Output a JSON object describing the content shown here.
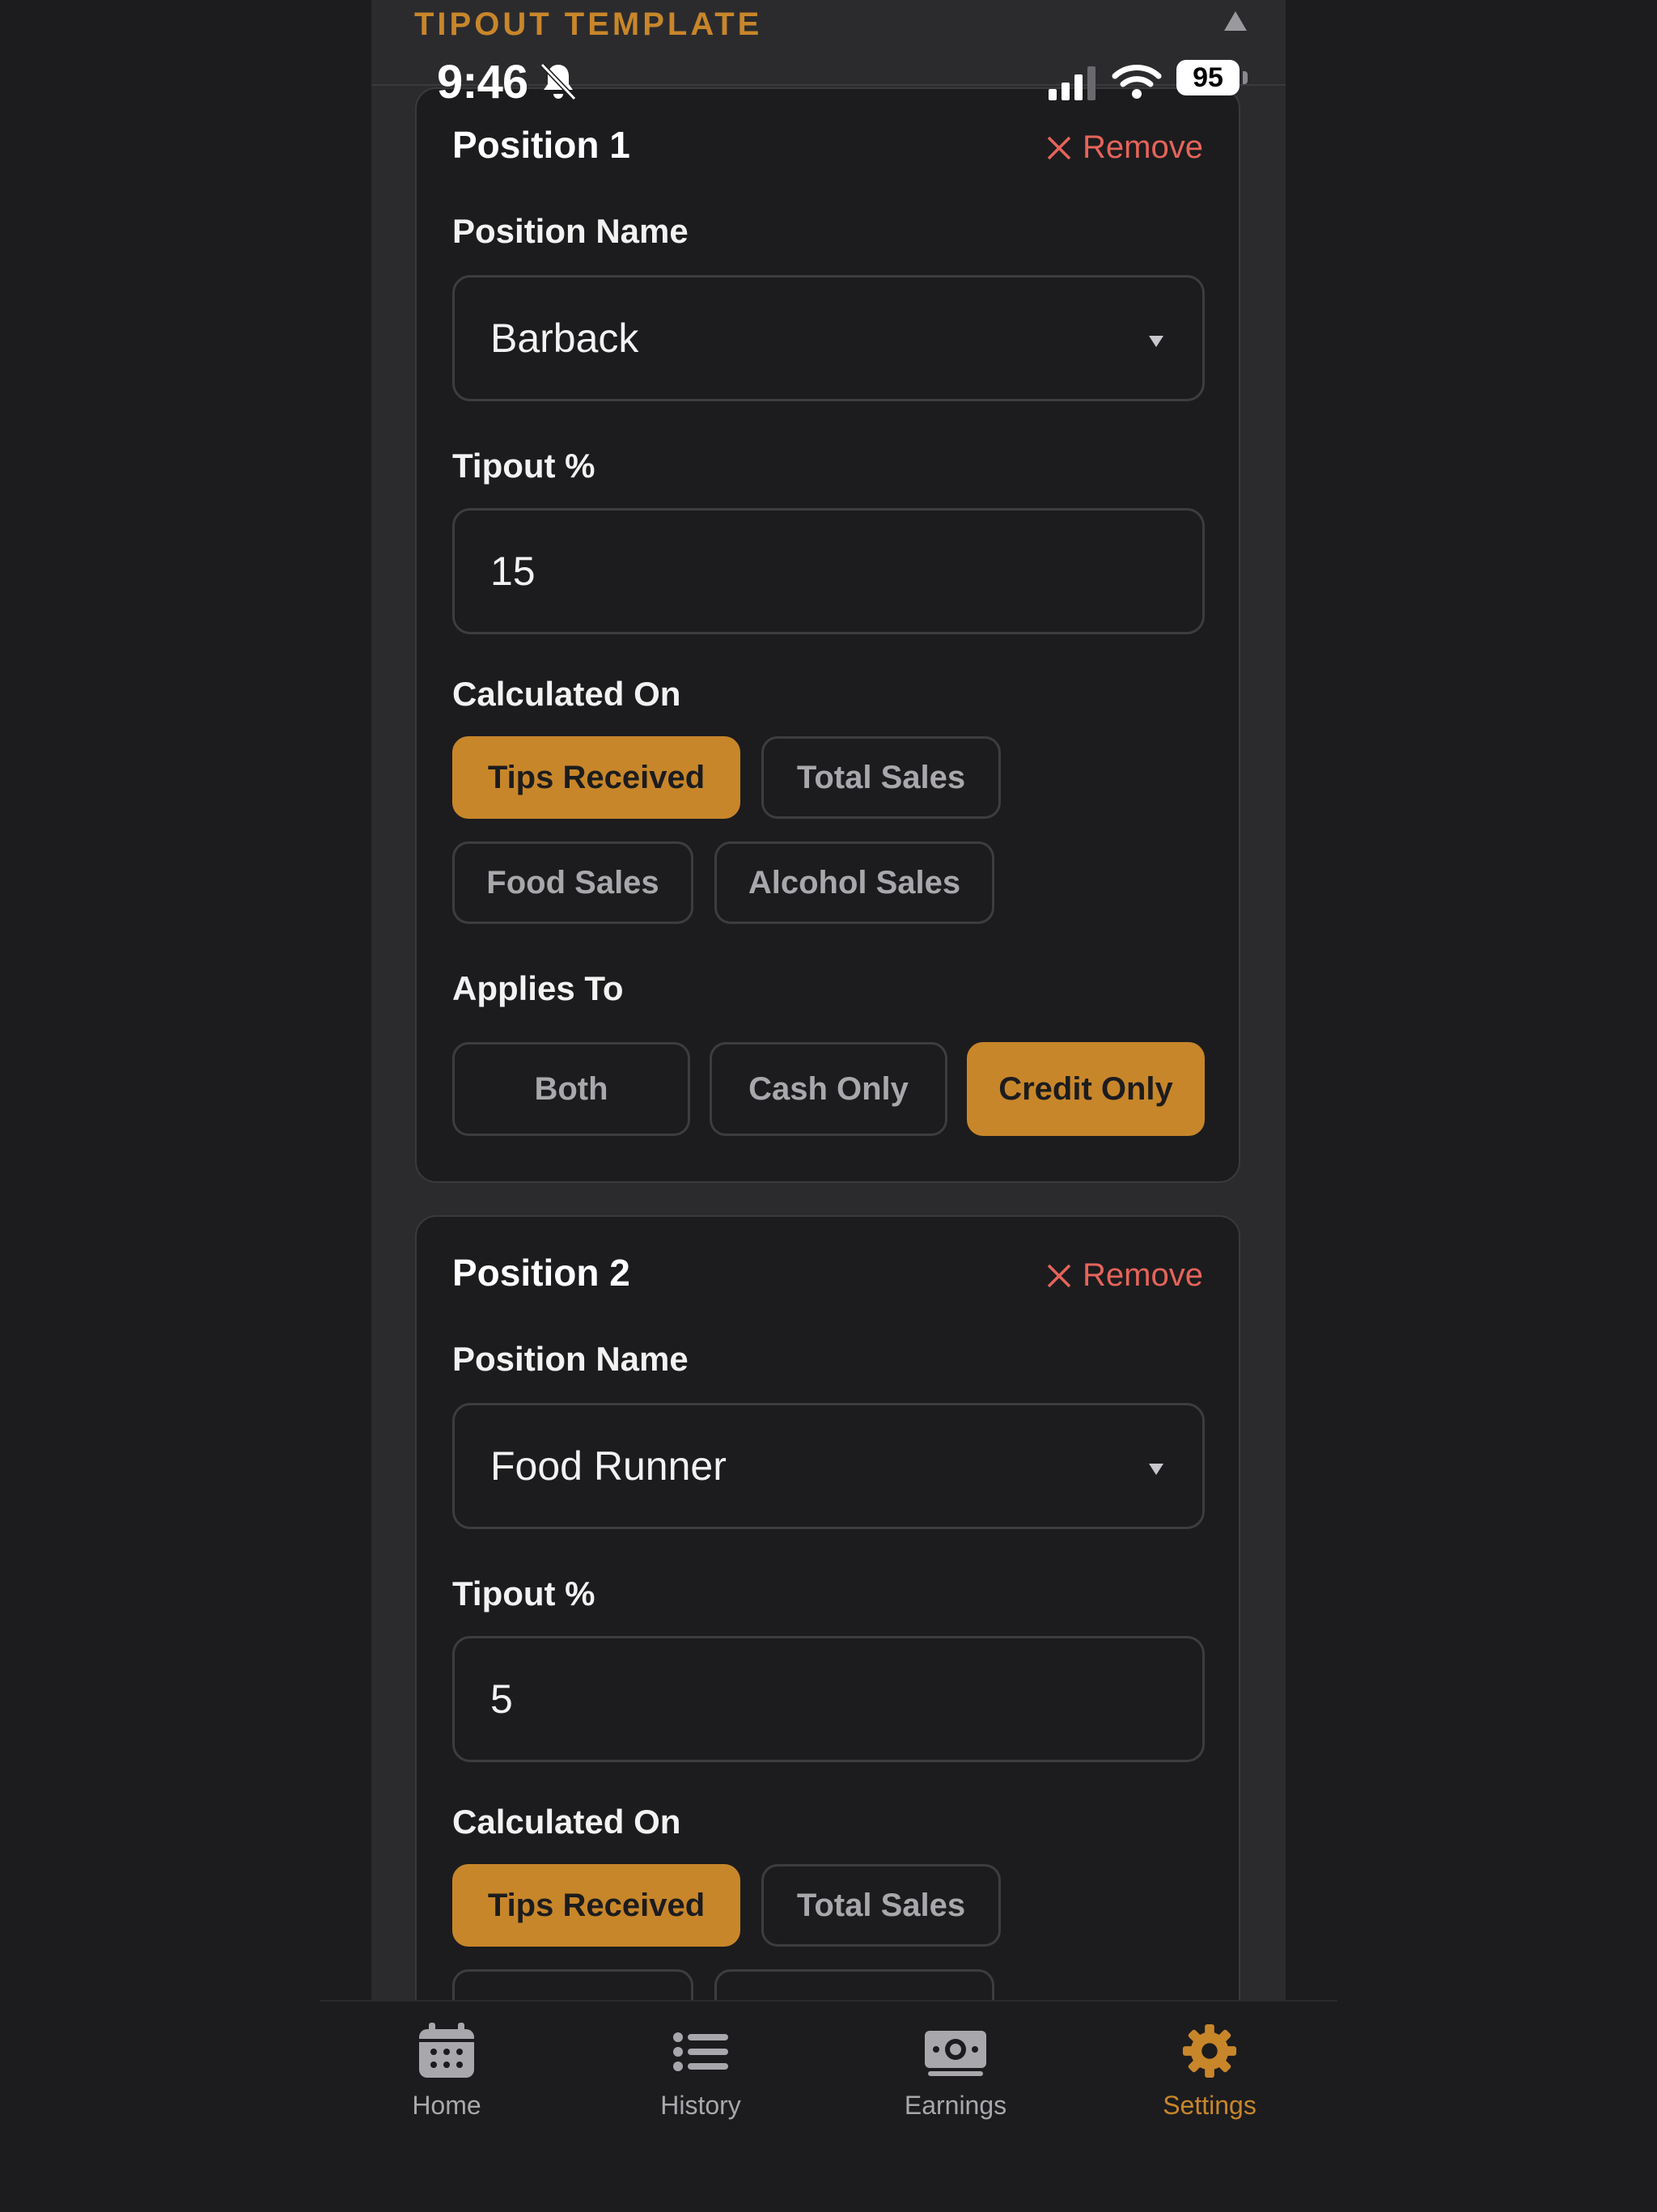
{
  "section": {
    "title": "TIPOUT TEMPLATE"
  },
  "status_bar": {
    "time": "9:46",
    "battery": "95"
  },
  "positions": [
    {
      "title": "Position 1",
      "remove_label": "Remove",
      "name_label": "Position Name",
      "name_value": "Barback",
      "tipout_label": "Tipout %",
      "tipout_value": "15",
      "calculated_on_label": "Calculated On",
      "calculated_on_options": [
        "Tips Received",
        "Total Sales",
        "Food Sales",
        "Alcohol Sales"
      ],
      "calculated_on_selected": "Tips Received",
      "applies_to_label": "Applies To",
      "applies_to_options": [
        "Both",
        "Cash Only",
        "Credit Only"
      ],
      "applies_to_selected": "Credit Only"
    },
    {
      "title": "Position 2",
      "remove_label": "Remove",
      "name_label": "Position Name",
      "name_value": "Food Runner",
      "tipout_label": "Tipout %",
      "tipout_value": "5",
      "calculated_on_label": "Calculated On",
      "calculated_on_options": [
        "Tips Received",
        "Total Sales"
      ],
      "calculated_on_selected": "Tips Received"
    }
  ],
  "tab_bar": {
    "items": [
      {
        "label": "Home",
        "icon": "calendar-icon"
      },
      {
        "label": "History",
        "icon": "list-icon"
      },
      {
        "label": "Earnings",
        "icon": "money-icon"
      },
      {
        "label": "Settings",
        "icon": "gear-icon"
      }
    ],
    "active": "Settings"
  },
  "colors": {
    "accent": "#c8862a",
    "danger": "#e5645a",
    "background": "#1c1c1e",
    "panel": "#2b2b2e"
  }
}
